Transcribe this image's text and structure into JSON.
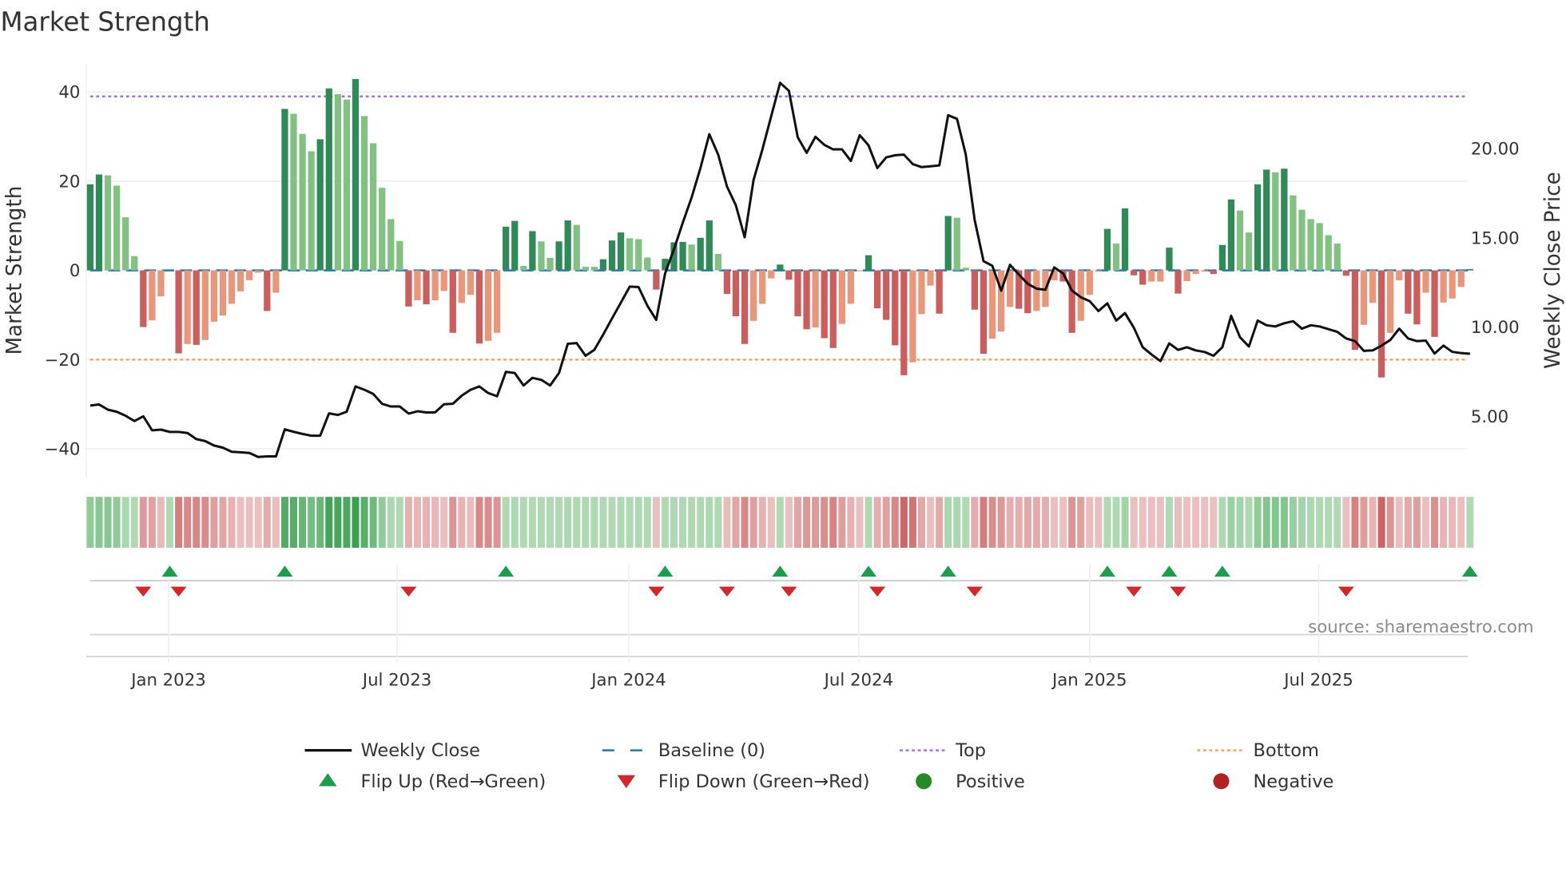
{
  "chart_data": {
    "type": "bar+line",
    "title": "Market Strength",
    "ylabel_left": "Market Strength",
    "ylabel_right": "Weekly Close Price",
    "ylim_left": [
      -46.3,
      46.3
    ],
    "ylim_right": [
      1.6,
      24.75
    ],
    "left_ticks": [
      {
        "value": 40,
        "label": "40"
      },
      {
        "value": 20,
        "label": "20"
      },
      {
        "value": 0,
        "label": "0"
      },
      {
        "value": -20,
        "label": "−20"
      },
      {
        "value": -40,
        "label": "−40"
      }
    ],
    "right_ticks": [
      {
        "value": 20,
        "label": "20.00"
      },
      {
        "value": 15,
        "label": "15.00"
      },
      {
        "value": 10,
        "label": "10.00"
      },
      {
        "value": 5,
        "label": "5.00"
      }
    ],
    "x_start_date": "2022-10-31",
    "x_interval": "weekly",
    "x_ticks": [
      {
        "week": 8.86,
        "label": "Jan 2023"
      },
      {
        "week": 34.7,
        "label": "Jul 2023"
      },
      {
        "week": 60.9,
        "label": "Jan 2024"
      },
      {
        "week": 86.9,
        "label": "Jul 2024"
      },
      {
        "week": 113.0,
        "label": "Jan 2025"
      },
      {
        "week": 138.9,
        "label": "Jul 2025"
      }
    ],
    "grid": true,
    "top_level": 39,
    "bottom_level": -20,
    "baseline": 0,
    "strength": [
      19.3,
      21.5,
      21.3,
      19,
      11.9,
      3.2,
      -12.7,
      -11.2,
      -5.8,
      0.2,
      -18.6,
      -16.5,
      -16.7,
      -15.6,
      -11.5,
      -10.1,
      -7.5,
      -4.7,
      -2.2,
      -0.5,
      -9.1,
      -5,
      36.2,
      35.1,
      30.6,
      26.7,
      29.4,
      40.8,
      39.5,
      38.3,
      42.9,
      34.6,
      28.5,
      18.5,
      11.5,
      6.6,
      -8.1,
      -6.7,
      -7.6,
      -6.7,
      -4.6,
      -14,
      -7.3,
      -5.5,
      -16.4,
      -15.8,
      -14,
      9.8,
      11.1,
      1,
      8.8,
      6.5,
      2.8,
      6.5,
      11.2,
      10.2,
      0.8,
      0.8,
      2.5,
      6.7,
      8.5,
      7.2,
      7,
      2.9,
      -4.3,
      2.6,
      6.3,
      6.4,
      5.8,
      7.3,
      11.2,
      3.7,
      -5.3,
      -10.3,
      -16.5,
      -11.3,
      -7.5,
      -1.8,
      1.3,
      -2.1,
      -10.3,
      -13.2,
      -12.8,
      -15.2,
      -17.4,
      -12,
      -7.5,
      -0.2,
      3.4,
      -8.5,
      -11.1,
      -16.8,
      -23.5,
      -20.6,
      -9.8,
      -3.4,
      -9.7,
      12.2,
      11.8,
      0.6,
      -8.8,
      -18.7,
      -15.3,
      -13.7,
      -8.2,
      -8.6,
      -9.6,
      -9.1,
      -8.2,
      -2.2,
      -2.5,
      -14,
      -11.3,
      -5.5,
      -0.3,
      9.3,
      6,
      13.9,
      -1.1,
      -3.2,
      -2.5,
      -2.5,
      5.1,
      -5.2,
      -2.4,
      -0.8,
      -0.3,
      -0.8,
      5.7,
      15.9,
      13.4,
      8.5,
      19.3,
      22.6,
      22,
      22.8,
      16.8,
      13.6,
      11.5,
      10.6,
      7.9,
      6,
      -1.2,
      -17.8,
      -12.2,
      -7.3,
      -24,
      -14,
      -2.2,
      -9.7,
      -12.1,
      -5,
      -14.9,
      -7.2,
      -6.3,
      -3.7,
      0.3
    ],
    "weekly_close": [
      5.6,
      5.66,
      5.37,
      5.25,
      5.03,
      4.73,
      5.0,
      4.21,
      4.25,
      4.12,
      4.12,
      4.06,
      3.72,
      3.61,
      3.36,
      3.24,
      3.01,
      2.98,
      2.94,
      2.72,
      2.75,
      2.75,
      4.27,
      4.13,
      4.01,
      3.91,
      3.91,
      5.16,
      5.07,
      5.25,
      6.67,
      6.48,
      6.25,
      5.7,
      5.55,
      5.55,
      5.15,
      5.28,
      5.21,
      5.22,
      5.67,
      5.7,
      6.15,
      6.48,
      6.67,
      6.3,
      6.12,
      7.49,
      7.42,
      6.72,
      7.15,
      7.04,
      6.72,
      7.42,
      9.06,
      9.1,
      8.39,
      8.72,
      9.58,
      10.48,
      11.37,
      12.27,
      12.24,
      11.19,
      10.4,
      13.01,
      14.36,
      15.85,
      17.27,
      18.91,
      20.81,
      19.66,
      17.87,
      16.82,
      15.03,
      18.24,
      19.96,
      21.82,
      23.69,
      23.24,
      20.63,
      19.76,
      20.66,
      20.21,
      19.96,
      19.96,
      19.31,
      20.75,
      20.18,
      18.91,
      19.51,
      19.63,
      19.66,
      19.13,
      18.96,
      19.01,
      19.06,
      21.87,
      21.67,
      19.66,
      16.0,
      13.69,
      13.43,
      12.04,
      13.49,
      12.94,
      12.42,
      12.15,
      12.09,
      13.34,
      13.01,
      12.04,
      11.67,
      11.45,
      10.9,
      11.33,
      10.36,
      10.78,
      9.96,
      8.87,
      8.46,
      8.09,
      9.09,
      8.72,
      8.87,
      8.69,
      8.6,
      8.39,
      8.87,
      10.63,
      9.43,
      8.91,
      10.36,
      10.1,
      10.03,
      10.21,
      10.33,
      9.91,
      10.1,
      10.03,
      9.88,
      9.73,
      9.36,
      9.21,
      8.66,
      8.69,
      8.96,
      9.28,
      9.91,
      9.36,
      9.21,
      9.24,
      8.51,
      8.96,
      8.61,
      8.54,
      8.5
    ],
    "flip_up_weeks": [
      9,
      22,
      47,
      65,
      78,
      88,
      97,
      115,
      122,
      128,
      156
    ],
    "flip_down_weeks": [
      6,
      10,
      36,
      64,
      72,
      79,
      89,
      100,
      118,
      123,
      142
    ],
    "legend": {
      "placement": "bottom",
      "items": [
        {
          "label": "Weekly Close",
          "kind": "line"
        },
        {
          "label": "Baseline (0)",
          "kind": "dash"
        },
        {
          "label": "Top",
          "kind": "dot-top"
        },
        {
          "label": "Bottom",
          "kind": "dot-bottom"
        },
        {
          "label": "Flip Up (Red→Green)",
          "kind": "tri-up"
        },
        {
          "label": "Flip Down (Green→Red)",
          "kind": "tri-down"
        },
        {
          "label": "Positive",
          "kind": "circle-pos"
        },
        {
          "label": "Negative",
          "kind": "circle-neg"
        }
      ]
    },
    "source": "source: sharemaestro.com",
    "colors": {
      "pos_strong": "#2e8b57",
      "pos_weak": "#82c182",
      "neg_strong": "#cd5c5c",
      "neg_weak": "#e9967a",
      "line": "#111111",
      "baseline": "#1f77b4",
      "top": "#a56de2",
      "bottom": "#f4a460",
      "flip_up": "#1a9e4a",
      "flip_down": "#d62728",
      "positive": "#228b22",
      "negative": "#b22222"
    }
  }
}
